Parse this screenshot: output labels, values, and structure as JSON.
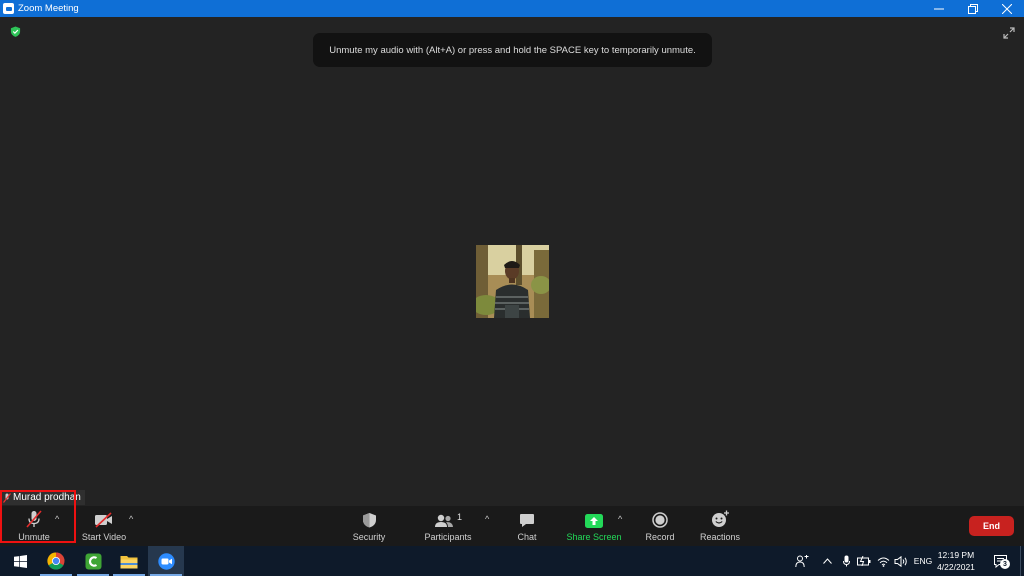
{
  "window": {
    "title": "Zoom Meeting",
    "controls": [
      "minimize",
      "restore",
      "close"
    ]
  },
  "meeting": {
    "tooltip": "Unmute my audio with (Alt+A) or press and hold the SPACE key to temporarily unmute.",
    "participant_name": "Murad prodhan"
  },
  "toolbar": {
    "unmute_label": "Unmute",
    "start_video_label": "Start Video",
    "security_label": "Security",
    "participants_label": "Participants",
    "participants_count": "1",
    "chat_label": "Chat",
    "share_screen_label": "Share Screen",
    "record_label": "Record",
    "reactions_label": "Reactions",
    "end_label": "End",
    "share_color": "#23d959",
    "end_color": "#c8221f"
  },
  "taskbar": {
    "apps": [
      "windows-start",
      "chrome",
      "camtasia",
      "file-explorer",
      "zoom"
    ],
    "tray": {
      "language": "ENG",
      "time": "12:19 PM",
      "date": "4/22/2021",
      "notification_count": "3"
    }
  }
}
